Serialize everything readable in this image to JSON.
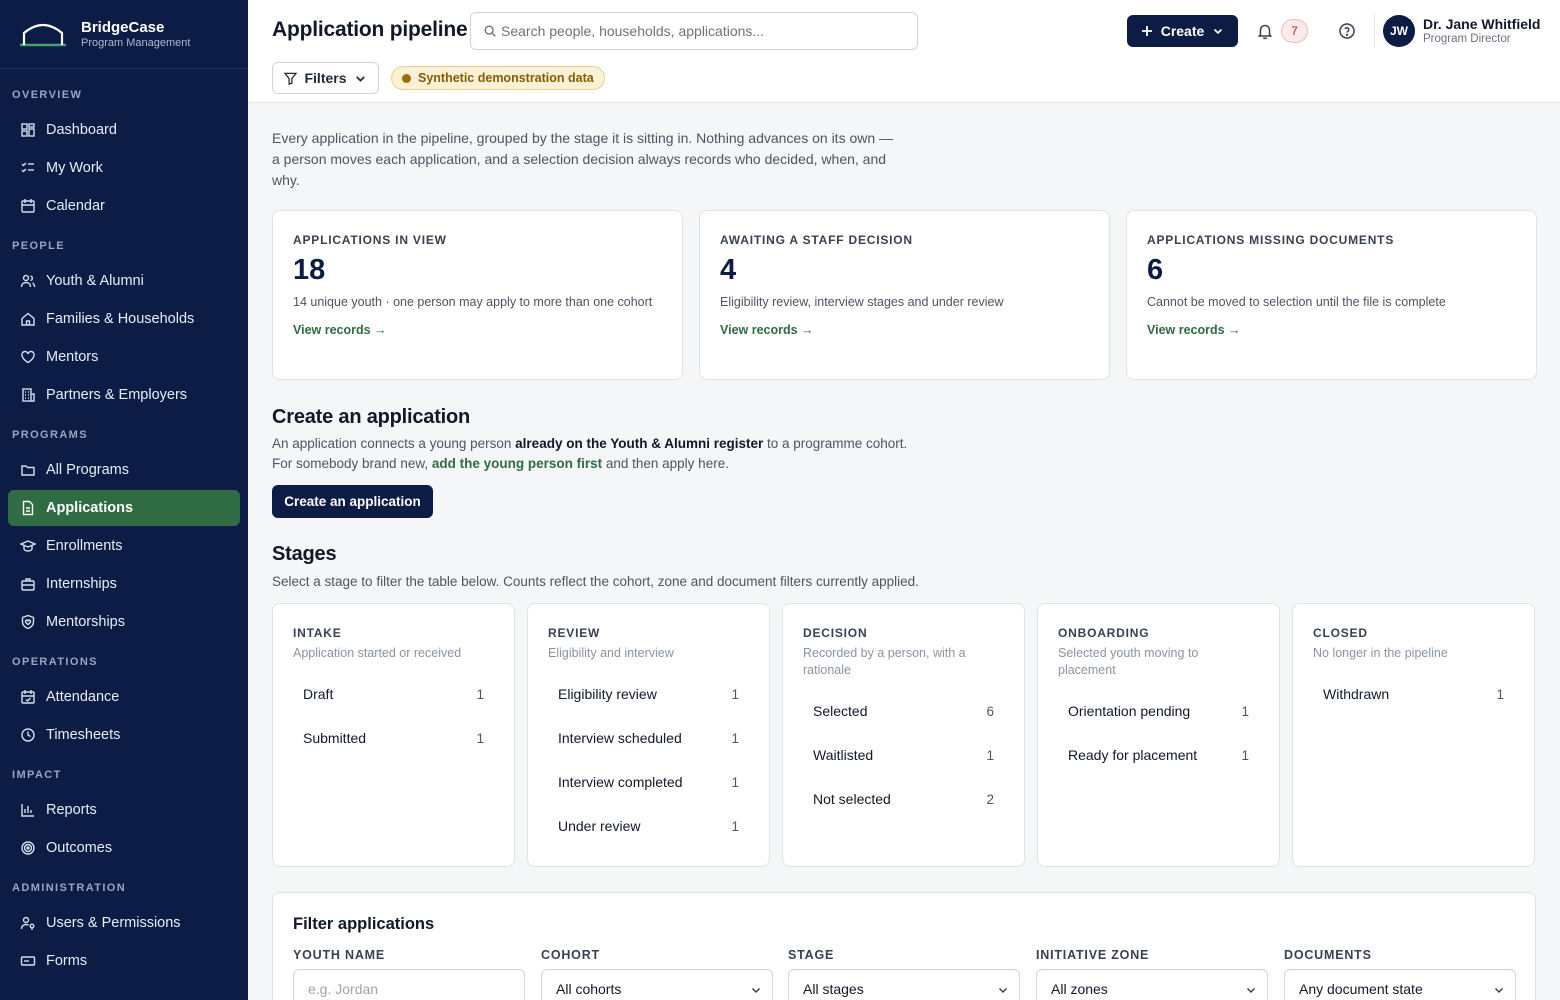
{
  "brand": {
    "name": "BridgeCase",
    "subtitle": "Program Management"
  },
  "sidebar": {
    "sections": [
      {
        "title": "OVERVIEW",
        "items": [
          {
            "label": "Dashboard",
            "icon": "grid-icon"
          },
          {
            "label": "My Work",
            "icon": "checklist-icon"
          },
          {
            "label": "Calendar",
            "icon": "calendar-icon"
          }
        ]
      },
      {
        "title": "PEOPLE",
        "items": [
          {
            "label": "Youth & Alumni",
            "icon": "users-icon"
          },
          {
            "label": "Families & Households",
            "icon": "home-icon"
          },
          {
            "label": "Mentors",
            "icon": "heart-icon"
          },
          {
            "label": "Partners & Employers",
            "icon": "building-icon"
          }
        ]
      },
      {
        "title": "PROGRAMS",
        "items": [
          {
            "label": "All Programs",
            "icon": "folder-icon"
          },
          {
            "label": "Applications",
            "icon": "document-icon",
            "active": true
          },
          {
            "label": "Enrollments",
            "icon": "graduation-icon"
          },
          {
            "label": "Internships",
            "icon": "briefcase-icon"
          },
          {
            "label": "Mentorships",
            "icon": "shield-heart-icon"
          }
        ]
      },
      {
        "title": "OPERATIONS",
        "items": [
          {
            "label": "Attendance",
            "icon": "calendar-check-icon"
          },
          {
            "label": "Timesheets",
            "icon": "clock-icon"
          }
        ]
      },
      {
        "title": "IMPACT",
        "items": [
          {
            "label": "Reports",
            "icon": "bar-chart-icon"
          },
          {
            "label": "Outcomes",
            "icon": "target-icon"
          }
        ]
      },
      {
        "title": "ADMINISTRATION",
        "items": [
          {
            "label": "Users & Permissions",
            "icon": "user-key-icon"
          },
          {
            "label": "Forms",
            "icon": "form-icon"
          }
        ]
      }
    ]
  },
  "header": {
    "title": "Application pipeline",
    "search_placeholder": "Search people, households, applications...",
    "create_label": "Create",
    "notification_count": "7",
    "user": {
      "initials": "JW",
      "name": "Dr. Jane Whitfield",
      "role": "Program Director"
    },
    "filters_label": "Filters",
    "synthetic_badge": "Synthetic demonstration data"
  },
  "intro": "Every application in the pipeline, grouped by the stage it is sitting in. Nothing advances on its own — a person moves each application, and a selection decision always records who decided, when, and why.",
  "stats": [
    {
      "label": "APPLICATIONS IN VIEW",
      "value": "18",
      "desc": "14 unique youth · one person may apply to more than one cohort",
      "link": "View records →"
    },
    {
      "label": "AWAITING A STAFF DECISION",
      "value": "4",
      "desc": "Eligibility review, interview stages and under review",
      "link": "View records →"
    },
    {
      "label": "APPLICATIONS MISSING DOCUMENTS",
      "value": "6",
      "desc": "Cannot be moved to selection until the file is complete",
      "link": "View records →"
    }
  ],
  "create_section": {
    "title": "Create an application",
    "line1_a": "An application connects a young person ",
    "line1_b": "already on the Youth & Alumni register",
    "line1_c": " to a programme cohort.",
    "line2_a": "For somebody brand new, ",
    "line2_link": "add the young person first",
    "line2_c": " and then apply here.",
    "button": "Create an application"
  },
  "stages_section": {
    "title": "Stages",
    "subtitle": "Select a stage to filter the table below. Counts reflect the cohort, zone and document filters currently applied.",
    "stages": [
      {
        "name": "INTAKE",
        "desc": "Application started or received",
        "rows": [
          {
            "label": "Draft",
            "count": "1"
          },
          {
            "label": "Submitted",
            "count": "1"
          }
        ]
      },
      {
        "name": "REVIEW",
        "desc": "Eligibility and interview",
        "rows": [
          {
            "label": "Eligibility review",
            "count": "1"
          },
          {
            "label": "Interview scheduled",
            "count": "1"
          },
          {
            "label": "Interview completed",
            "count": "1"
          },
          {
            "label": "Under review",
            "count": "1"
          }
        ]
      },
      {
        "name": "DECISION",
        "desc": "Recorded by a person, with a rationale",
        "rows": [
          {
            "label": "Selected",
            "count": "6"
          },
          {
            "label": "Waitlisted",
            "count": "1"
          },
          {
            "label": "Not selected",
            "count": "2"
          }
        ]
      },
      {
        "name": "ONBOARDING",
        "desc": "Selected youth moving to placement",
        "rows": [
          {
            "label": "Orientation pending",
            "count": "1"
          },
          {
            "label": "Ready for placement",
            "count": "1"
          }
        ]
      },
      {
        "name": "CLOSED",
        "desc": "No longer in the pipeline",
        "rows": [
          {
            "label": "Withdrawn",
            "count": "1"
          }
        ]
      }
    ]
  },
  "filter_panel": {
    "title": "Filter applications",
    "fields": [
      {
        "label": "YOUTH NAME",
        "placeholder": "e.g. Jordan"
      },
      {
        "label": "COHORT",
        "value": "All cohorts"
      },
      {
        "label": "STAGE",
        "value": "All stages"
      },
      {
        "label": "INITIATIVE ZONE",
        "value": "All zones"
      },
      {
        "label": "DOCUMENTS",
        "value": "Any document state"
      }
    ]
  },
  "colors": {
    "navy": "#0c1c45",
    "green_active": "#2f6b43",
    "badge_amber": "#fbf1d6"
  }
}
